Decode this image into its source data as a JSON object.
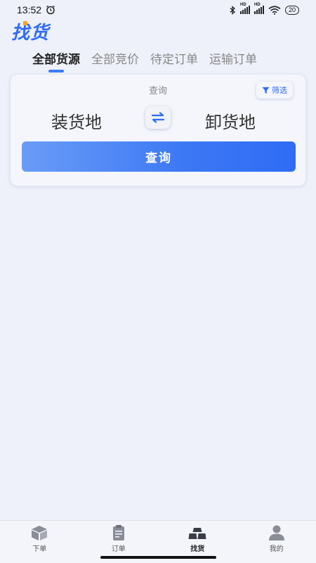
{
  "status_bar": {
    "time": "13:52",
    "signal_tag_1": "HD",
    "signal_tag_2": "HD",
    "battery": "20"
  },
  "header": {
    "title": "找货"
  },
  "tabs": [
    {
      "label": "全部货源",
      "active": true
    },
    {
      "label": "全部竞价",
      "active": false
    },
    {
      "label": "待定订单",
      "active": false
    },
    {
      "label": "运输订单",
      "active": false
    }
  ],
  "search_card": {
    "label": "查询",
    "filter_label": "筛选",
    "origin": "装货地",
    "destination": "卸货地",
    "query_button": "查询"
  },
  "bottom_nav": [
    {
      "label": "下单",
      "icon": "box-icon",
      "active": false
    },
    {
      "label": "订单",
      "icon": "clipboard-icon",
      "active": false
    },
    {
      "label": "找货",
      "icon": "cargo-stack-icon",
      "active": true
    },
    {
      "label": "我的",
      "icon": "user-icon",
      "active": false
    }
  ],
  "colors": {
    "accent": "#2f6cf6",
    "background": "#eef1fa"
  }
}
